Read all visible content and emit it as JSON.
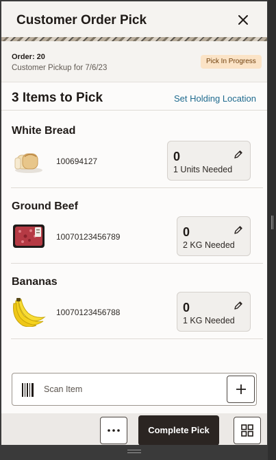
{
  "header": {
    "title": "Customer Order Pick",
    "close_icon": "close-icon"
  },
  "order": {
    "number": "Order: 20",
    "pickup": "Customer Pickup for 7/6/23",
    "status": "Pick In Progress",
    "status_colors": {
      "bg": "#fbe3c6",
      "text": "#6d3d09"
    }
  },
  "pick": {
    "title": "3 Items to Pick",
    "holding_link": "Set Holding Location"
  },
  "items": [
    {
      "name": "White Bread",
      "code": "100694127",
      "qty": "0",
      "needed": "1 Units Needed",
      "image": "bread-image",
      "edit_icon": "pencil-icon"
    },
    {
      "name": "Ground Beef",
      "code": "10070123456789",
      "qty": "0",
      "needed": "2 KG Needed",
      "image": "ground-beef-image",
      "edit_icon": "pencil-icon"
    },
    {
      "name": "Bananas",
      "code": "10070123456788",
      "qty": "0",
      "needed": "1 KG Needed",
      "image": "bananas-image",
      "edit_icon": "pencil-icon"
    }
  ],
  "scan": {
    "placeholder": "Scan Item",
    "icon": "barcode-icon",
    "add_icon": "plus-icon"
  },
  "footer": {
    "more_icon": "more-horizontal-icon",
    "complete_label": "Complete Pick",
    "grid_icon": "grid-icon"
  },
  "colors": {
    "link": "#1e6a8e",
    "primary_button": "#2b2522",
    "surface": "#f5f3f0"
  }
}
